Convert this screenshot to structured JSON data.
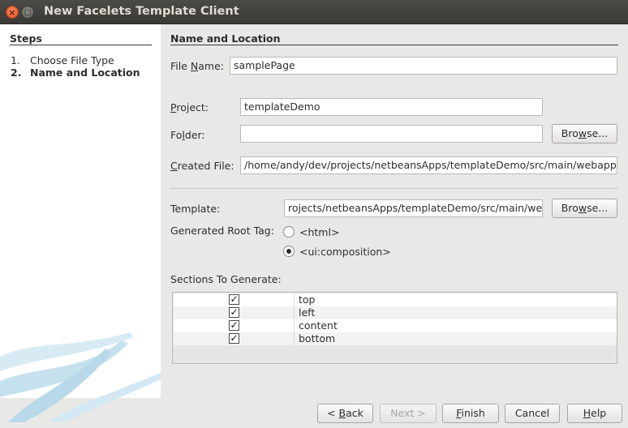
{
  "window": {
    "title": "New Facelets Template Client",
    "close_glyph": "×",
    "max_glyph": "□"
  },
  "steps": {
    "title": "Steps",
    "items": [
      {
        "num": "1.",
        "label": "Choose File Type",
        "current": false
      },
      {
        "num": "2.",
        "label": "Name and Location",
        "current": true
      }
    ]
  },
  "form": {
    "section_title": "Name and Location",
    "file_name": {
      "label_pre": "File ",
      "label_mn": "N",
      "label_post": "ame:",
      "value": "samplePage"
    },
    "project": {
      "label_mn": "P",
      "label_post": "roject:",
      "value": "templateDemo"
    },
    "folder": {
      "label_pre": "Fo",
      "label_mn": "l",
      "label_post": "der:",
      "value": ""
    },
    "created_file": {
      "label_mn": "C",
      "label_post": "reated File:",
      "value": "/home/andy/dev/projects/netbeansApps/templateDemo/src/main/webapp/"
    },
    "template": {
      "label_pre": "Template:",
      "value": "rojects/netbeansApps/templateDemo/src/main/we"
    },
    "browse_pre": "Bro",
    "browse_mn": "w",
    "browse_post": "se...",
    "template_browse_pre": "Bro",
    "template_browse_mn": "w",
    "template_browse_post": "se...",
    "root_tag_label": "Generated Root Tag:",
    "root_tag_options": [
      {
        "label": "<html>",
        "checked": false
      },
      {
        "label": "<ui:composition>",
        "checked": true
      }
    ],
    "sections_label": "Sections To Generate:",
    "sections": [
      {
        "name": "top",
        "checked": true
      },
      {
        "name": "left",
        "checked": true
      },
      {
        "name": "content",
        "checked": true
      },
      {
        "name": "bottom",
        "checked": true
      }
    ],
    "check_glyph": "✓"
  },
  "footer": {
    "back": {
      "pre": "< ",
      "mn": "B",
      "post": "ack"
    },
    "next": "Next >",
    "finish": {
      "mn": "F",
      "post": "inish"
    },
    "cancel": "Cancel",
    "help": {
      "mn": "H",
      "post": "elp"
    }
  },
  "colors": {
    "titlebar": "#3f3e3a",
    "close_button": "#e85f2c",
    "steps_panel": "#ffffff",
    "swoosh": "#b9d9ea"
  }
}
